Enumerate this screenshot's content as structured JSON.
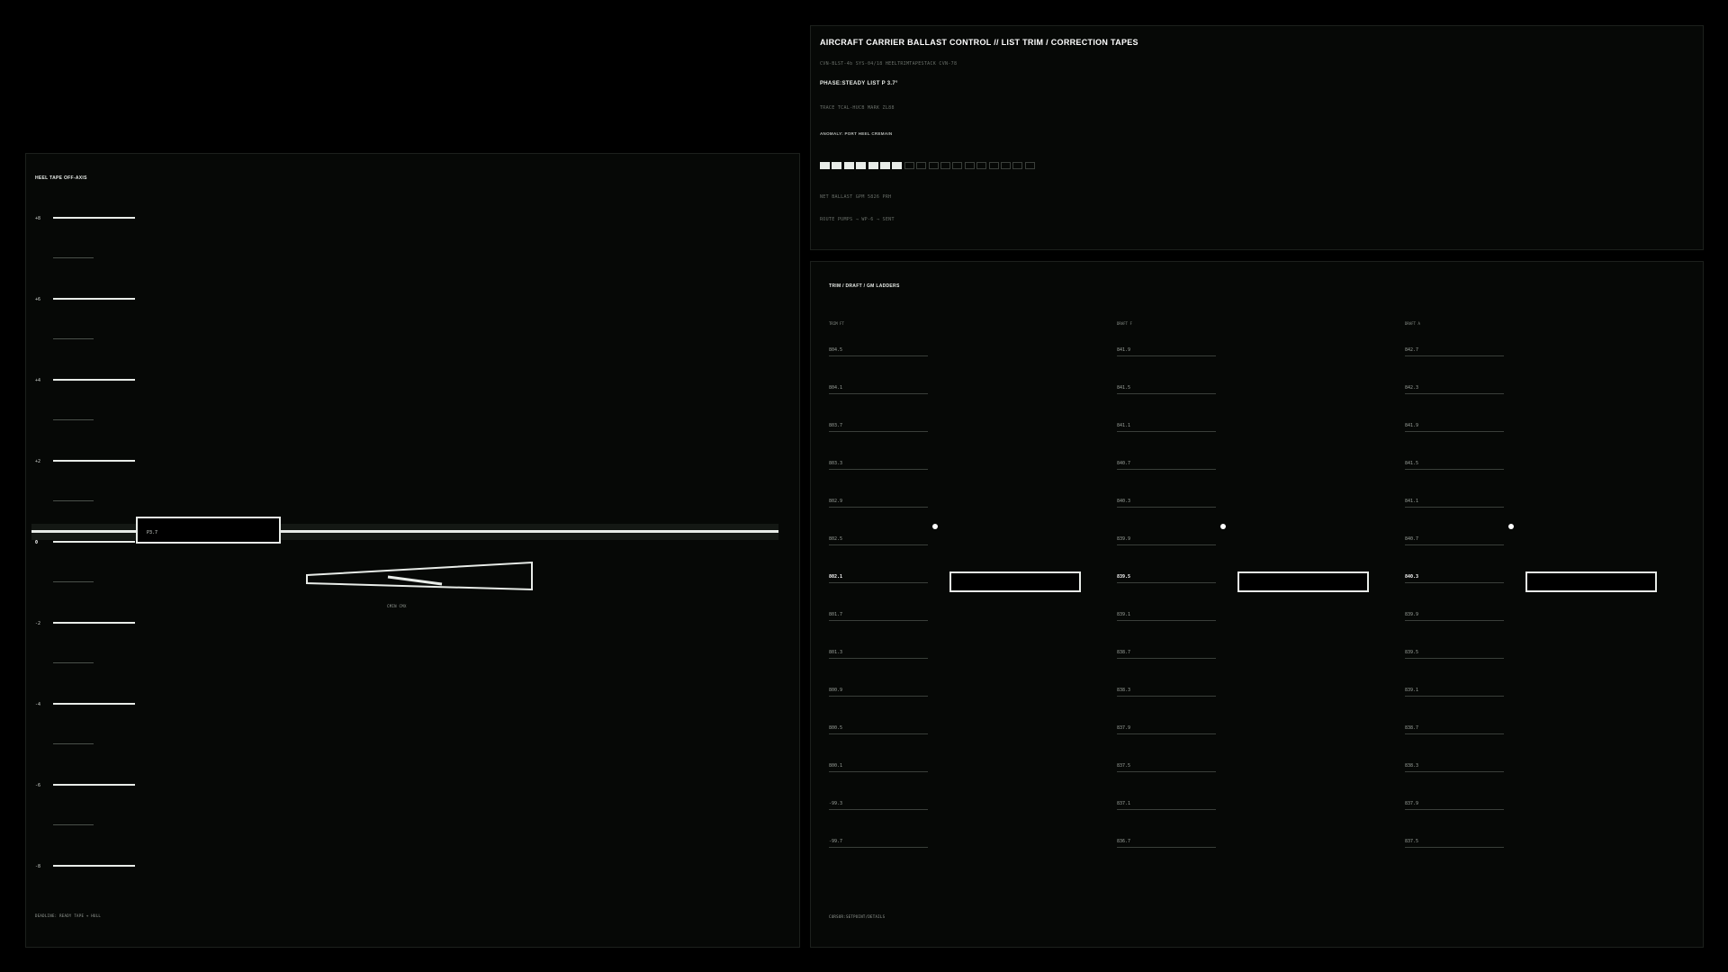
{
  "status_panel": {
    "title": "AIRCRAFT CARRIER BALLAST CONTROL  //  LIST TRIM / CORRECTION TAPES",
    "meta_line": "CVN-BLST-4b   SYS-04/18   HEELTRIMTAPESTACK   CVN-78",
    "phase_line": "PHASE:STEADY   LIST P 3.7°",
    "trace_line": "TRACE  TCAL-HUCB   MARK  ZL88",
    "anomaly_label": "ANOMALY: PORT HEEL CREMAIN",
    "segments": {
      "total": 18,
      "filled": 7,
      "fill_fraction": 0.389
    },
    "ballast_line": "NET BALLAST GPM   5826   PRH",
    "route_line": "ROUTE  PUMPS  → WP-6  →  SENT"
  },
  "heel_panel": {
    "title": "HEEL TAPE  OFF-AXIS",
    "ticks": [
      "+8",
      "+6",
      "+4",
      "+2",
      "0",
      "-2",
      "-4",
      "-6",
      "-8"
    ],
    "readout": "P3.7",
    "annotation": "CMIN  CMX",
    "footer": "DEADLINE: READY TAPE + HULL"
  },
  "ladder_panel": {
    "title": "TRIM / DRAFT / GM  LADDERS",
    "footer": "CURSOR:SETPOINT/DETAILS",
    "columns": [
      {
        "header": "TRIM FT",
        "current_index": 6,
        "values": [
          "804.5",
          "804.1",
          "803.7",
          "803.3",
          "802.9",
          "802.5",
          "802.1",
          "801.7",
          "801.3",
          "800.9",
          "800.5",
          "800.1",
          "-99.3",
          "-99.7"
        ]
      },
      {
        "header": "DRAFT F",
        "current_index": 6,
        "values": [
          "841.9",
          "841.5",
          "841.1",
          "840.7",
          "840.3",
          "839.9",
          "839.5",
          "839.1",
          "838.7",
          "838.3",
          "837.9",
          "837.5",
          "837.1",
          "836.7"
        ]
      },
      {
        "header": "DRAFT A",
        "current_index": 6,
        "values": [
          "842.7",
          "842.3",
          "841.9",
          "841.5",
          "841.1",
          "840.7",
          "840.3",
          "839.9",
          "839.5",
          "839.1",
          "838.7",
          "838.3",
          "837.9",
          "837.5"
        ]
      }
    ]
  },
  "colors": {
    "background": "#000000",
    "panel": "#060806",
    "accent": "#e8ece8",
    "dim": "#6a706a"
  }
}
